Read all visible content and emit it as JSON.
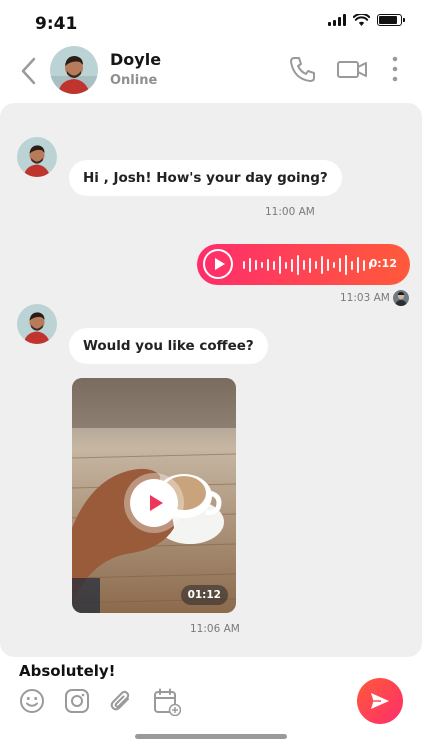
{
  "status_bar": {
    "time": "9:41",
    "battery_level": 0.85
  },
  "header": {
    "contact_name": "Doyle",
    "contact_status": "Online",
    "icons": [
      "back-icon",
      "phone-icon",
      "video-camera-icon",
      "more-vertical-icon"
    ]
  },
  "messages": [
    {
      "type": "text",
      "direction": "incoming",
      "text": "Hi , Josh! How's your day going?",
      "time": "11:00 AM"
    },
    {
      "type": "voice",
      "direction": "outgoing",
      "duration": "0:12",
      "time": "11:03 AM"
    },
    {
      "type": "text",
      "direction": "incoming",
      "text": "Would you like coffee?"
    },
    {
      "type": "video",
      "direction": "incoming",
      "duration": "01:12",
      "time": "11:06 AM"
    }
  ],
  "composer": {
    "value": "Absolutely!",
    "tools": [
      "emoji-icon",
      "instagram-icon",
      "attachment-icon",
      "calendar-add-icon"
    ],
    "send_icon": "send-icon"
  },
  "colors": {
    "accent_start": "#ff5a3a",
    "accent_end": "#ff2d6c",
    "chat_bg": "#efefef"
  }
}
